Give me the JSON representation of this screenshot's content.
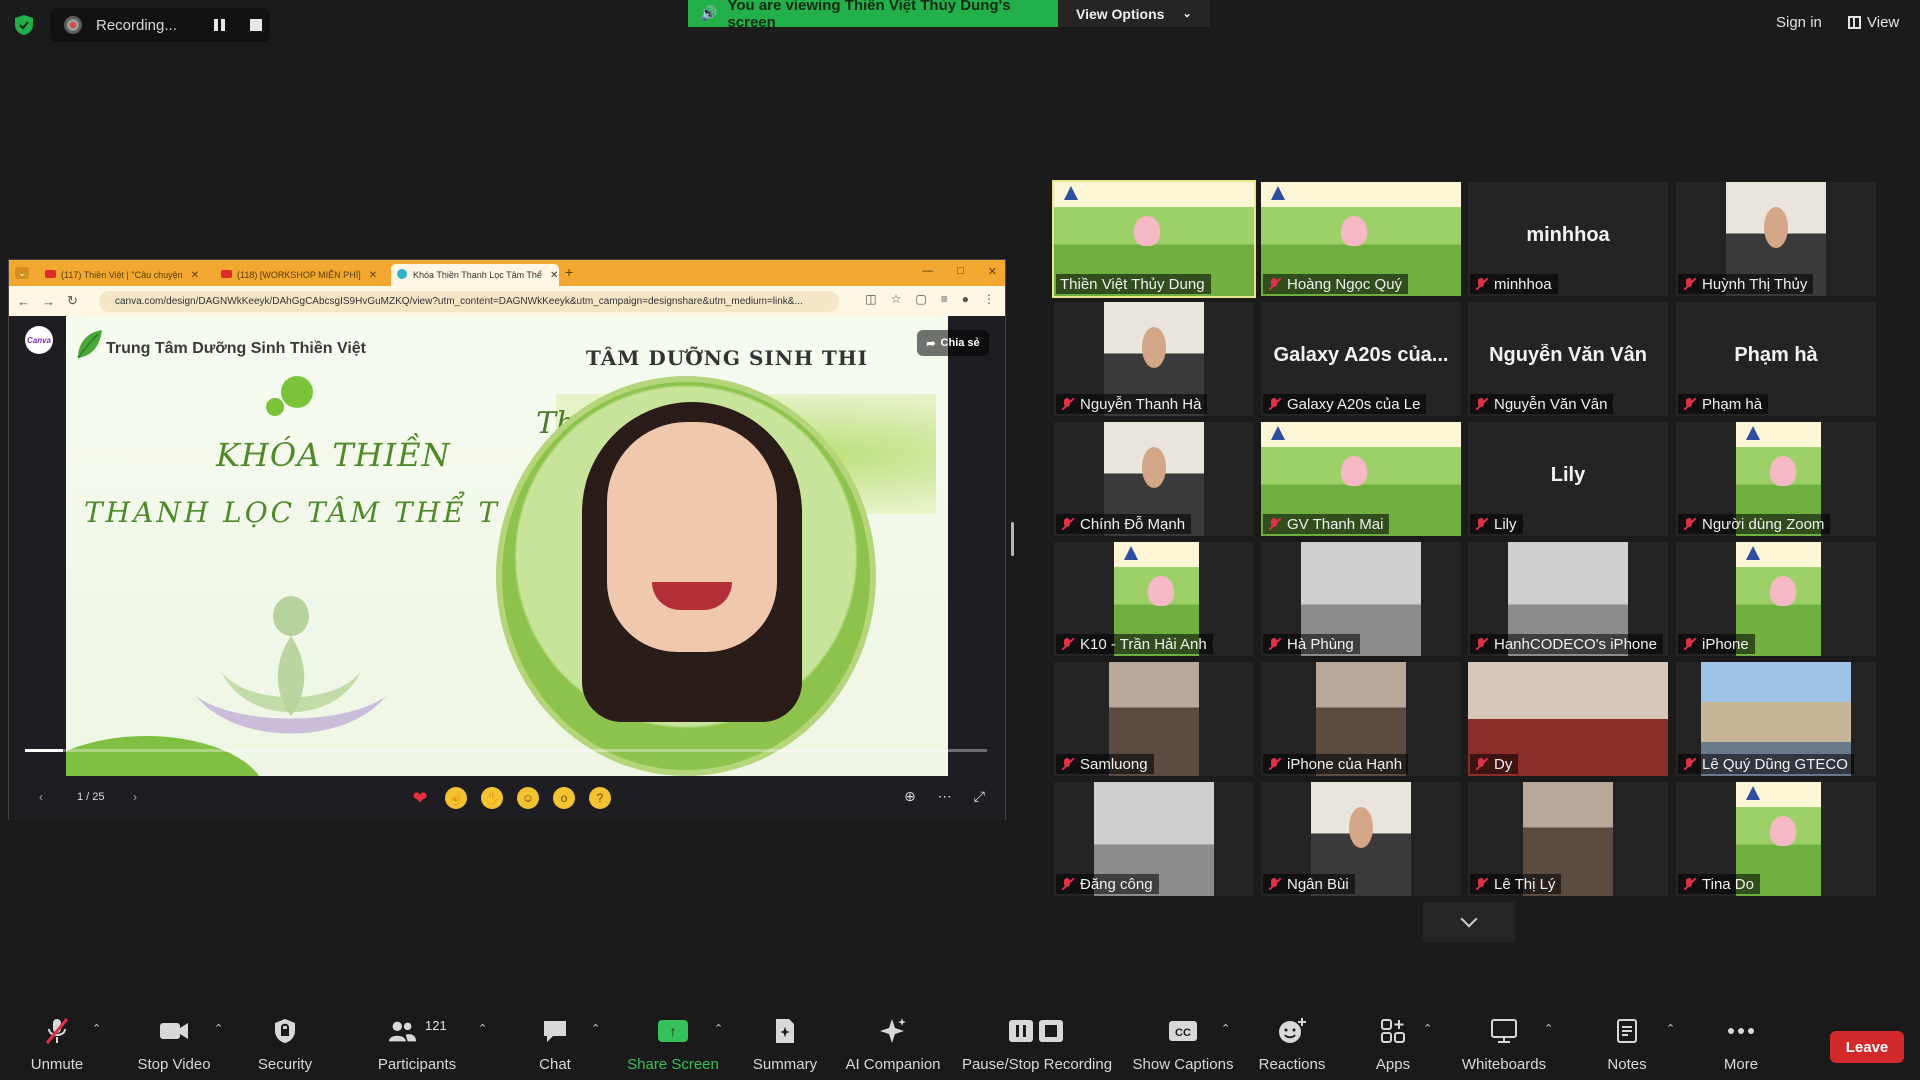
{
  "topbar": {
    "recording_label": "Recording...",
    "viewing_banner": "You are viewing Thiền Việt Thủy Dung's screen",
    "view_options_label": "View Options",
    "sign_in_label": "Sign in",
    "view_label": "View"
  },
  "browser": {
    "tabs": [
      "(117) Thiền Việt | \"Câu chuyện",
      "(118) [WORKSHOP MIỄN PHÍ]",
      "Khóa Thiền Thanh Lọc Tâm Thể"
    ],
    "url": "canva.com/design/DAGNWkKeeyk/DAhGgCAbcsgIS9HvGuMZKQ/view?utm_content=DAGNWkKeeyk&utm_campaign=designshare&utm_medium=link&..."
  },
  "slide": {
    "org_name": "Trung Tâm Dưỡng Sinh Thiền Việt",
    "heading_line1": "KHÓA THIỀN",
    "heading_line2": "THANH LỌC TÂM THỂ T",
    "centre_text": "TÂM DƯỠNG SINH THI",
    "tagline": "Thi            ức khỏe",
    "share_label": "Chia sẻ",
    "page_indicator": "1 / 25",
    "logo_text": "Canva",
    "progress_fraction": 0.04
  },
  "gallery": [
    {
      "name": "Thiền Việt Thủy Dung",
      "video": "lotus-person",
      "muted": false,
      "active": true
    },
    {
      "name": "Hoàng Ngọc Quý",
      "video": "lotus-person",
      "muted": true
    },
    {
      "name": "minhhoa",
      "big": "minhhoa",
      "muted": true
    },
    {
      "name": "Huỳnh Thị Thủy",
      "video": "person",
      "muted": true
    },
    {
      "name": "Nguyễn Thanh Hà",
      "video": "person",
      "muted": true
    },
    {
      "name": "Galaxy A20s của Le",
      "big": "Galaxy A20s của...",
      "muted": true
    },
    {
      "name": "Nguyễn Văn Vân",
      "big": "Nguyễn Văn Vân",
      "muted": true
    },
    {
      "name": "Phạm hà",
      "big": "Phạm hà",
      "muted": true
    },
    {
      "name": "Chính Đỗ Mạnh",
      "video": "person",
      "muted": true
    },
    {
      "name": "GV Thanh Mai",
      "video": "lotus-person",
      "muted": true
    },
    {
      "name": "Lily",
      "big": "Lily",
      "muted": true
    },
    {
      "name": "Người dùng Zoom",
      "video": "lotus",
      "muted": true
    },
    {
      "name": "K10 - Trần Hải Anh",
      "video": "lotus",
      "muted": true
    },
    {
      "name": "Hà Phùng",
      "video": "room",
      "muted": true
    },
    {
      "name": "HanhCODECO's iPhone",
      "video": "room",
      "muted": true
    },
    {
      "name": "iPhone",
      "video": "lotus",
      "muted": true
    },
    {
      "name": "Samluong",
      "video": "room2",
      "muted": true
    },
    {
      "name": "iPhone của Hạnh",
      "video": "room2",
      "muted": true
    },
    {
      "name": "Dy",
      "video": "red",
      "muted": true
    },
    {
      "name": "Lê Quý Dũng GTECO",
      "video": "city",
      "muted": true
    },
    {
      "name": "Đăng công",
      "video": "room",
      "muted": true
    },
    {
      "name": "Ngân Bùi",
      "video": "person",
      "muted": true
    },
    {
      "name": "Lê Thị Lý",
      "video": "room2",
      "muted": true
    },
    {
      "name": "Tina Do",
      "video": "lotus",
      "muted": true
    }
  ],
  "toolbar": {
    "unmute": "Unmute",
    "stop_video": "Stop Video",
    "security": "Security",
    "participants": "Participants",
    "participants_count": "121",
    "chat": "Chat",
    "share_screen": "Share Screen",
    "summary": "Summary",
    "ai_companion": "AI Companion",
    "pause_stop_recording": "Pause/Stop Recording",
    "show_captions": "Show Captions",
    "reactions": "Reactions",
    "apps": "Apps",
    "whiteboards": "Whiteboards",
    "notes": "Notes",
    "more": "More",
    "leave": "Leave"
  },
  "colors": {
    "banner_green": "#23b04a",
    "leave_red": "#d22a2a",
    "active_speaker": "#e8e68a",
    "muted_red": "#e0304a"
  }
}
